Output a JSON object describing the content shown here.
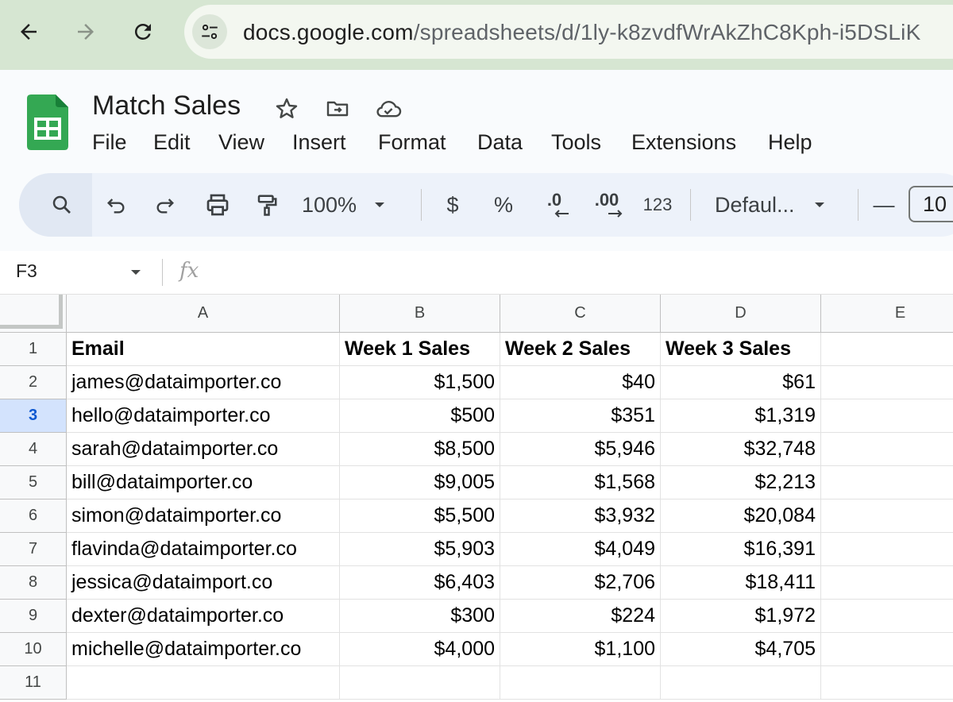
{
  "browser": {
    "url_host": "docs.google.com",
    "url_path": "/spreadsheets/d/1ly-k8zvdfWrAkZhC8Kph-i5DSLiK"
  },
  "doc": {
    "title": "Match Sales"
  },
  "menu": [
    "File",
    "Edit",
    "View",
    "Insert",
    "Format",
    "Data",
    "Tools",
    "Extensions",
    "Help"
  ],
  "toolbar": {
    "zoom": "100%",
    "currency": "$",
    "percent": "%",
    "decrease_decimal": ".0",
    "increase_decimal": ".00",
    "more_formats": "123",
    "font": "Defaul...",
    "minus": "—",
    "font_size": "10"
  },
  "formula_bar": {
    "name_box": "F3",
    "fx": "fx",
    "value": ""
  },
  "columns": [
    "A",
    "B",
    "C",
    "D",
    "E"
  ],
  "row_numbers": [
    "1",
    "2",
    "3",
    "4",
    "5",
    "6",
    "7",
    "8",
    "9",
    "10",
    "11"
  ],
  "selected_row": "3",
  "rows": [
    [
      "Email",
      "Week 1 Sales",
      "Week 2 Sales",
      "Week 3 Sales",
      ""
    ],
    [
      "james@dataimporter.co",
      "$1,500",
      "$40",
      "$61",
      ""
    ],
    [
      "hello@dataimporter.co",
      "$500",
      "$351",
      "$1,319",
      ""
    ],
    [
      "sarah@dataimporter.co",
      "$8,500",
      "$5,946",
      "$32,748",
      ""
    ],
    [
      "bill@dataimporter.co",
      "$9,005",
      "$1,568",
      "$2,213",
      ""
    ],
    [
      "simon@dataimporter.co",
      "$5,500",
      "$3,932",
      "$20,084",
      ""
    ],
    [
      "flavinda@dataimporter.co",
      "$5,903",
      "$4,049",
      "$16,391",
      ""
    ],
    [
      "jessica@dataimport.co",
      "$6,403",
      "$2,706",
      "$18,411",
      ""
    ],
    [
      "dexter@dataimporter.co",
      "$300",
      "$224",
      "$1,972",
      ""
    ],
    [
      "michelle@dataimporter.co",
      "$4,000",
      "$1,100",
      "$4,705",
      ""
    ],
    [
      "",
      "",
      "",
      "",
      ""
    ]
  ],
  "colors": {
    "browser_bar": "#d6e6d2",
    "sheets_green": "#34a853",
    "selection_blue": "#d3e3fd"
  }
}
